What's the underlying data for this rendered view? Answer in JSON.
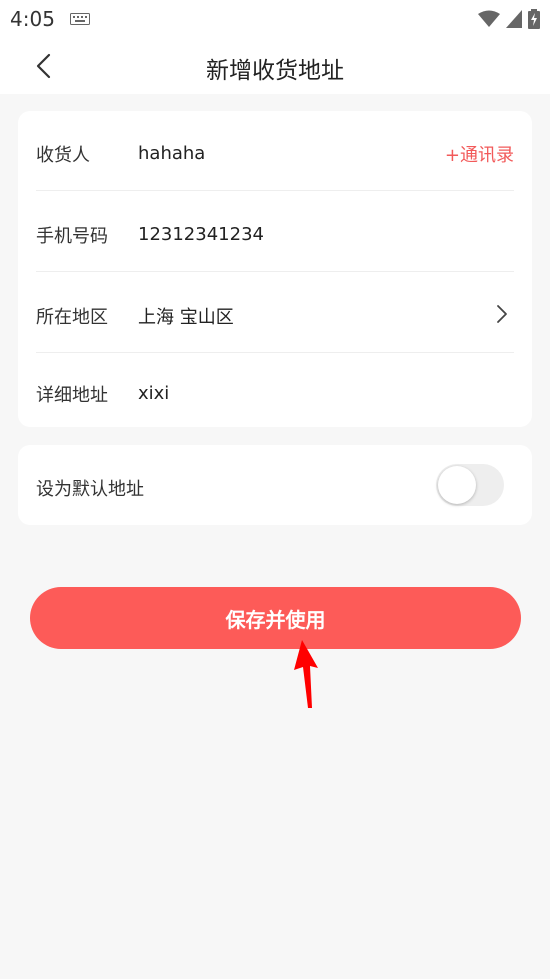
{
  "status_bar": {
    "time": "4:05"
  },
  "header": {
    "title": "新增收货地址"
  },
  "form": {
    "recipient": {
      "label": "收货人",
      "value": "hahaha",
      "contacts_link": "+通讯录"
    },
    "phone": {
      "label": "手机号码",
      "value": "12312341234"
    },
    "region": {
      "label": "所在地区",
      "value": "上海 宝山区"
    },
    "detail": {
      "label": "详细地址",
      "value": "xixi"
    }
  },
  "default_address": {
    "label": "设为默认地址",
    "enabled": false
  },
  "save_button": {
    "label": "保存并使用"
  },
  "colors": {
    "accent": "#fd5b58",
    "link": "#f25a5a",
    "annotation_arrow": "#ff0000"
  }
}
